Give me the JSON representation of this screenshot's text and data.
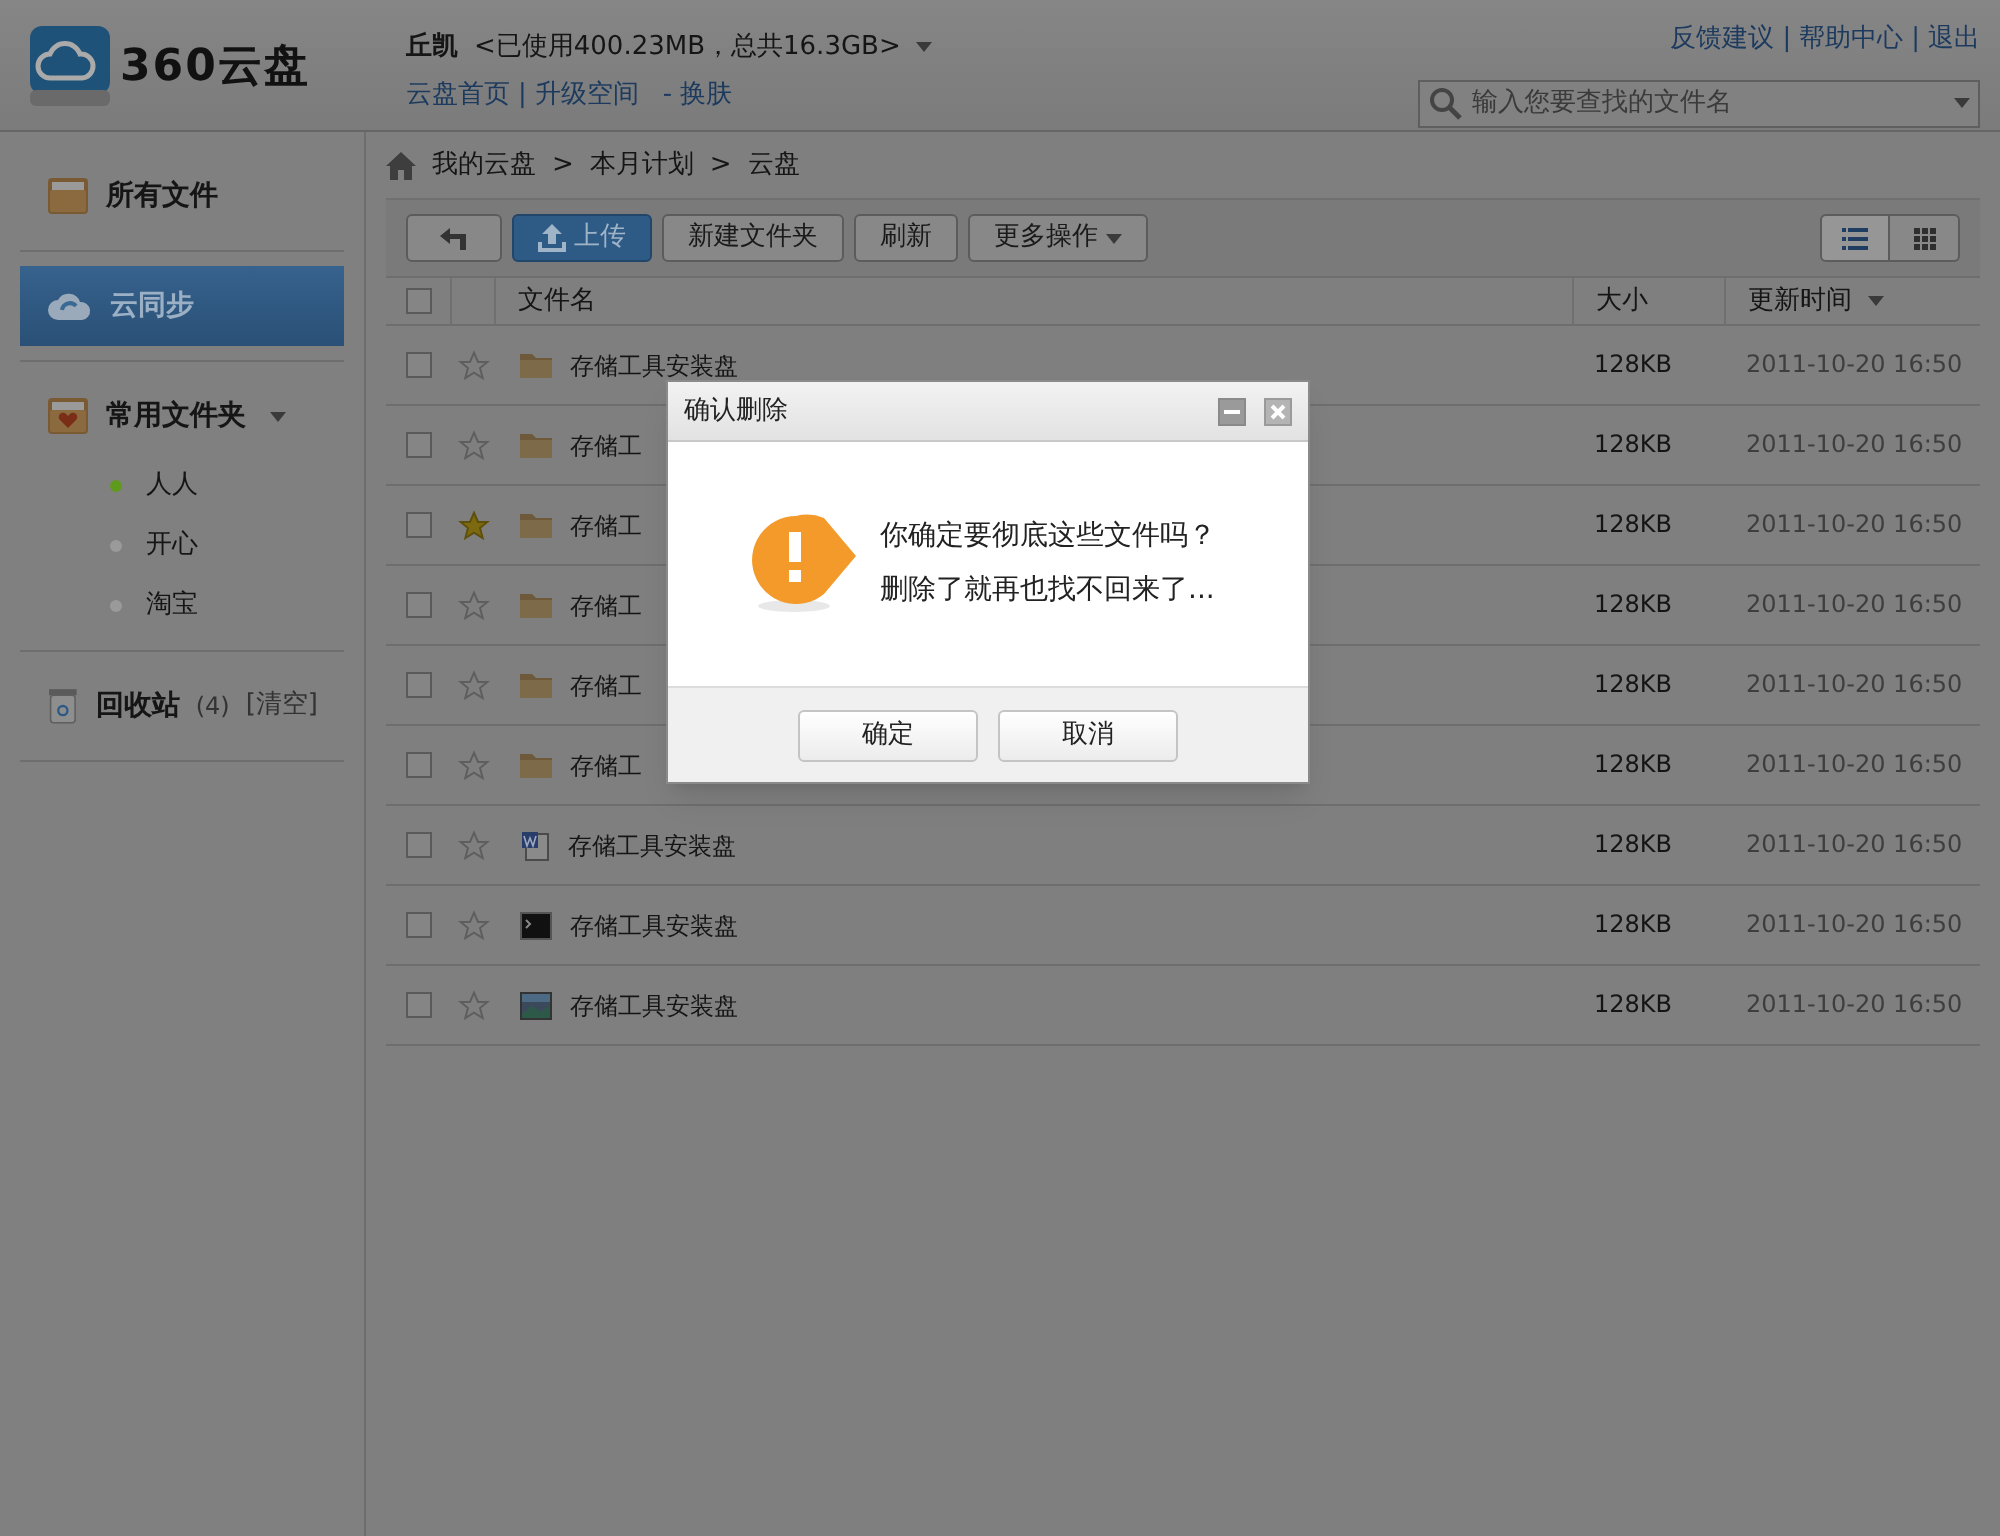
{
  "header": {
    "logo_text": "360云盘",
    "user": "丘凯",
    "usage": "<已使用400.23MB，总共16.3GB>",
    "separator": "|",
    "links": [
      "云盘首页",
      "升级空间"
    ],
    "skin_prefix": "-",
    "skin": "换肤",
    "top_links": [
      "反馈建议",
      "帮助中心",
      "退出"
    ],
    "search": {
      "placeholder": "输入您要查找的文件名"
    }
  },
  "sidebar": {
    "sections": [
      {
        "label": "所有文件",
        "kind": "folder",
        "selected": false
      },
      {
        "label": "云同步",
        "kind": "cloud",
        "selected": true
      },
      {
        "label": "常用文件夹",
        "kind": "heart-folder",
        "selected": false,
        "expanded": true,
        "children": [
          {
            "label": "人人",
            "color": "#5f9a1c"
          },
          {
            "label": "开心",
            "color": "#9a9a9a"
          },
          {
            "label": "淘宝",
            "color": "#9a9a9a"
          }
        ]
      },
      {
        "label": "回收站",
        "kind": "trash",
        "selected": false,
        "count": "(4)",
        "action": "[清空]"
      }
    ]
  },
  "breadcrumb": {
    "separator": ">",
    "items": [
      "我的云盘",
      "本月计划",
      "云盘"
    ]
  },
  "toolbar": {
    "buttons": [
      {
        "kind": "back"
      },
      {
        "kind": "upload",
        "label": "上传"
      },
      {
        "kind": "plain",
        "label": "新建文件夹"
      },
      {
        "kind": "plain",
        "label": "刷新"
      },
      {
        "kind": "dropdown",
        "label": "更多操作"
      }
    ],
    "views": [
      {
        "kind": "list",
        "selected": true
      },
      {
        "kind": "grid",
        "selected": false
      }
    ]
  },
  "table": {
    "all_checked": false,
    "columns": [
      {
        "label": "文件名",
        "sortable": false
      },
      {
        "label": "大小",
        "sortable": false
      },
      {
        "label": "更新时间",
        "sortable": true
      }
    ],
    "rows": [
      {
        "name": "存储工具安装盘",
        "kind": "folder",
        "starred": false,
        "checked": false,
        "size": "128KB",
        "modified": "2011-10-20 16:50"
      },
      {
        "name": "存储工",
        "kind": "folder",
        "starred": false,
        "checked": false,
        "size": "128KB",
        "modified": "2011-10-20 16:50"
      },
      {
        "name": "存储工",
        "kind": "folder",
        "starred": true,
        "checked": false,
        "size": "128KB",
        "modified": "2011-10-20 16:50"
      },
      {
        "name": "存储工",
        "kind": "folder",
        "starred": false,
        "checked": false,
        "size": "128KB",
        "modified": "2011-10-20 16:50"
      },
      {
        "name": "存储工",
        "kind": "folder",
        "starred": false,
        "checked": false,
        "size": "128KB",
        "modified": "2011-10-20 16:50"
      },
      {
        "name": "存储工",
        "kind": "folder",
        "starred": false,
        "checked": false,
        "size": "128KB",
        "modified": "2011-10-20 16:50"
      },
      {
        "name": "存储工具安装盘",
        "kind": "document",
        "starred": false,
        "checked": false,
        "size": "128KB",
        "modified": "2011-10-20 16:50"
      },
      {
        "name": "存储工具安装盘",
        "kind": "terminal",
        "starred": false,
        "checked": false,
        "size": "128KB",
        "modified": "2011-10-20 16:50"
      },
      {
        "name": "存储工具安装盘",
        "kind": "image",
        "starred": false,
        "checked": false,
        "size": "128KB",
        "modified": "2011-10-20 16:50"
      }
    ]
  },
  "dialog": {
    "title": "确认删除",
    "lines": [
      "你确定要彻底这些文件吗？",
      "删除了就再也找不回来了..."
    ],
    "buttons": [
      "确定",
      "取消"
    ]
  }
}
